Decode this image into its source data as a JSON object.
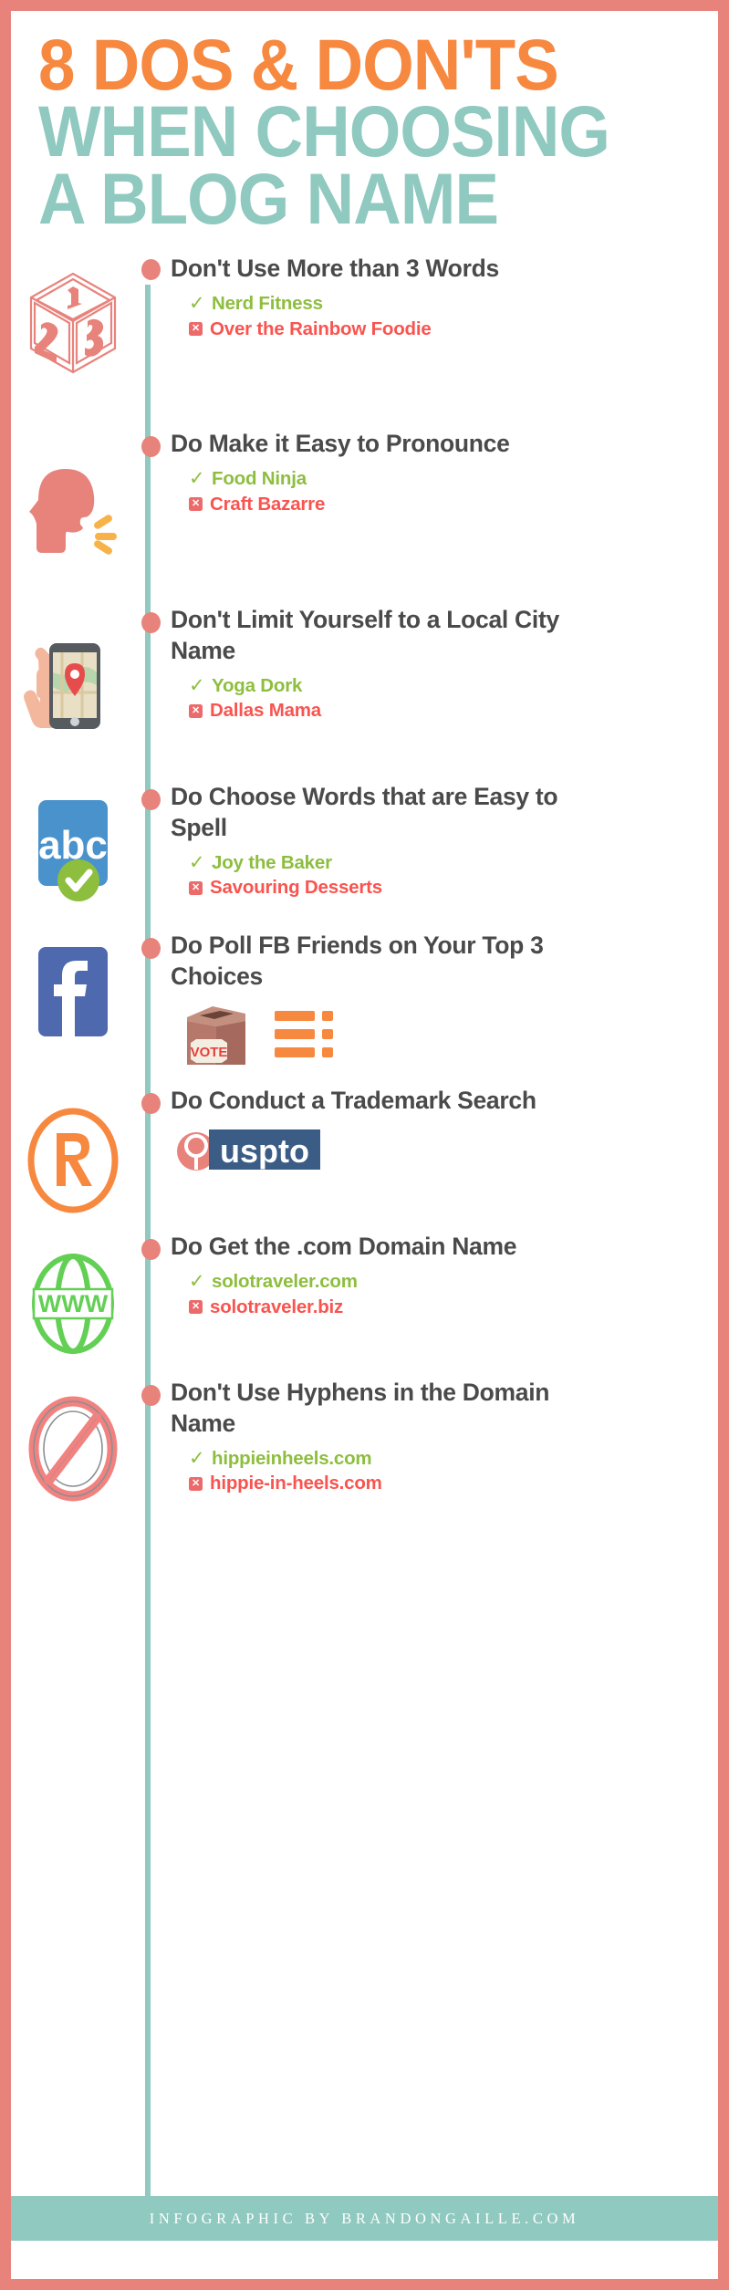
{
  "colors": {
    "border": "#e8837c",
    "orange": "#f7883f",
    "teal": "#8fc9bf",
    "headline": "#4a4a4a",
    "good_green": "#8dbe3e",
    "bad_red": "#f9544f",
    "x_box": "#ed6a6a",
    "facebook_blue": "#4e69ae",
    "abc_blue": "#4a92cc",
    "www_green": "#63d055",
    "uspto_navy": "#3b5c85",
    "vote_brown": "#b5786a"
  },
  "title": {
    "line1": "8 DOS & DON'TS",
    "line2": "WHEN CHOOSING",
    "line3": "A BLOG NAME"
  },
  "items": [
    {
      "icon": "abc-block-dice-icon",
      "heading": "Don't Use More than 3 Words",
      "good": "Nerd Fitness",
      "bad": "Over the Rainbow Foodie",
      "block_faces": [
        "1",
        "2",
        "3"
      ]
    },
    {
      "icon": "speaking-head-icon",
      "heading": "Do Make it Easy to Pronounce",
      "good": "Food Ninja",
      "bad": "Craft Bazarre"
    },
    {
      "icon": "hand-holding-phone-map-icon",
      "heading": "Don't Limit Yourself to a Local City Name",
      "good": "Yoga Dork",
      "bad": "Dallas Mama"
    },
    {
      "icon": "abc-spelling-icon",
      "heading": "Do Choose Words that are Easy to Spell",
      "good": "Joy the Baker",
      "bad": "Savouring Desserts",
      "icon_label": "abc"
    },
    {
      "icon": "facebook-icon",
      "heading": "Do Poll FB Friends on Your Top 3 Choices",
      "sub_icons": [
        "ballot-box-vote-icon",
        "poll-list-icon"
      ],
      "ballot_label": "VOTE"
    },
    {
      "icon": "registered-trademark-icon",
      "heading": "Do Conduct a Trademark Search",
      "sub_icons": [
        "uspto-logo-icon"
      ],
      "uspto_label": "uspto"
    },
    {
      "icon": "www-globe-icon",
      "heading": "Do Get the .com Domain Name",
      "good": "solotraveler.com",
      "bad": "solotraveler.biz",
      "icon_label": "WWW"
    },
    {
      "icon": "no-entry-prohibited-icon",
      "heading": "Don't Use Hyphens in the Domain Name",
      "good": "hippieinheels.com",
      "bad": "hippie-in-heels.com"
    }
  ],
  "footer": {
    "credit": "Infographic by BrandonGaille.com"
  },
  "glyphs": {
    "check": "✓",
    "cross": "✕"
  }
}
